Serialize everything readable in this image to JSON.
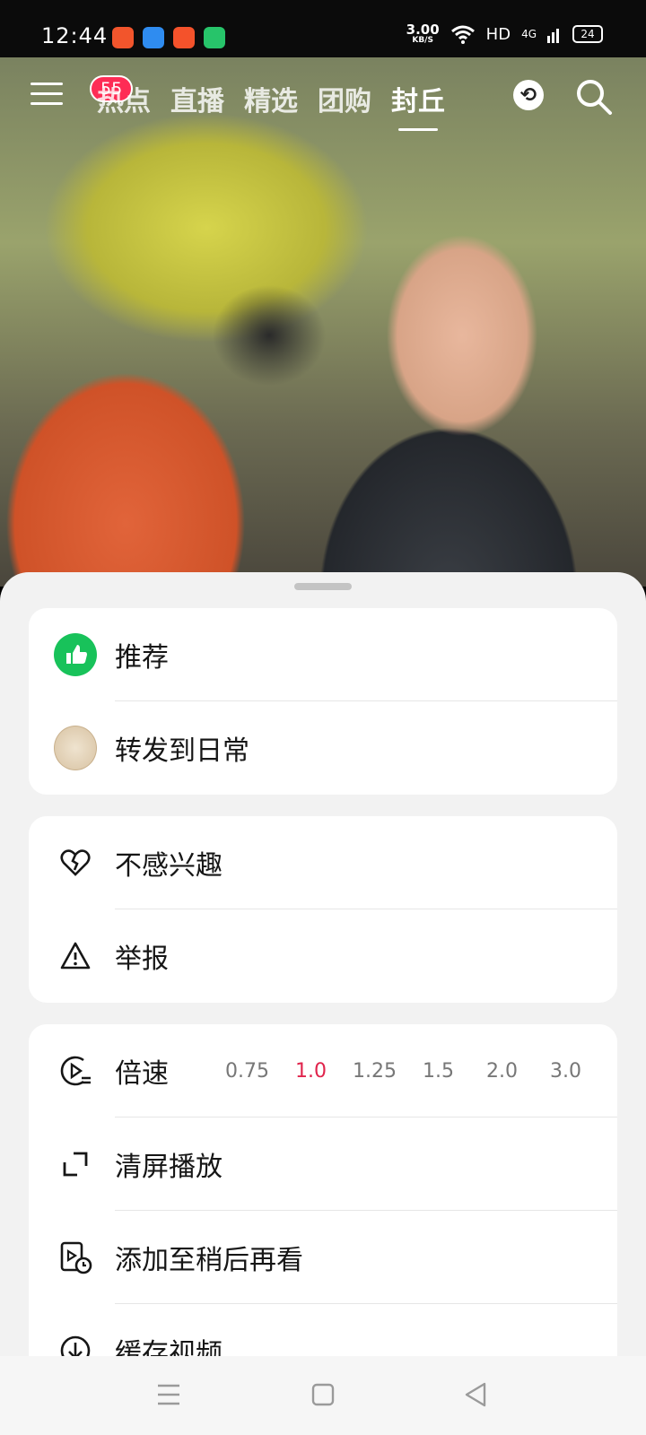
{
  "status_bar": {
    "time": "12:44",
    "net_speed": "3.00",
    "net_unit": "KB/S",
    "hd": "HD",
    "signal": "4G",
    "battery": "24"
  },
  "top_nav": {
    "badge": "55",
    "tabs": [
      "热点",
      "直播",
      "精选",
      "团购",
      "封丘"
    ],
    "active_tab": "封丘"
  },
  "sheet": {
    "group1": [
      {
        "label": "推荐",
        "icon": "thumbs-up-icon"
      },
      {
        "label": "转发到日常",
        "icon": "avatar"
      }
    ],
    "group2": [
      {
        "label": "不感兴趣",
        "icon": "broken-heart-icon"
      },
      {
        "label": "举报",
        "icon": "warning-icon"
      }
    ],
    "group3": {
      "speed_label": "倍速",
      "speeds": [
        "0.75",
        "1.0",
        "1.25",
        "1.5",
        "2.0",
        "3.0"
      ],
      "selected_speed": "1.0",
      "clear_screen": "清屏播放",
      "watch_later": "添加至稍后再看",
      "cache_video": "缓存视频"
    }
  },
  "colors": {
    "accent": "#fe2c55",
    "like_green": "#18c25a",
    "speed_active": "#e0244c"
  }
}
